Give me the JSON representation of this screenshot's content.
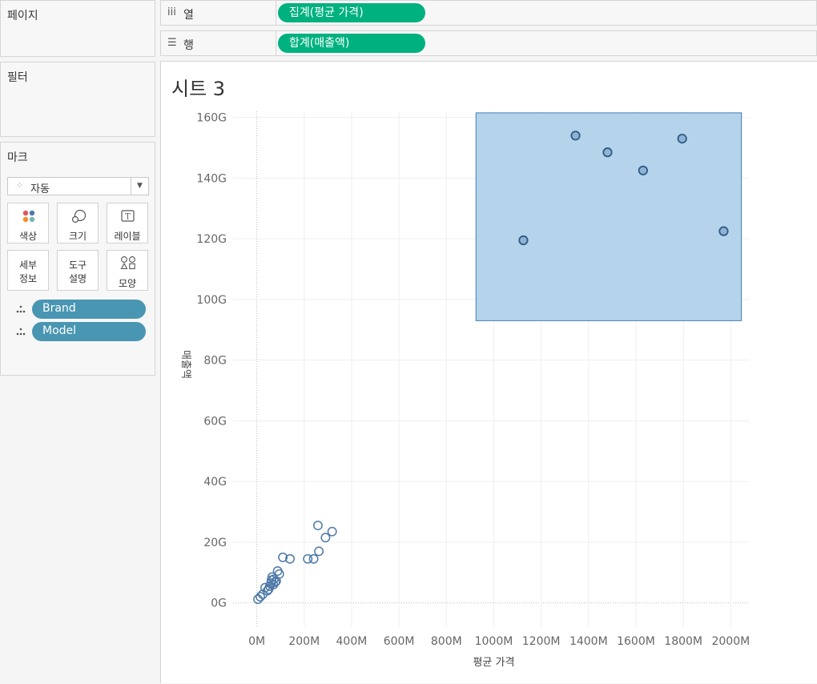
{
  "sidebar": {
    "pages_title": "페이지",
    "filters_title": "필터",
    "marks_title": "마크",
    "mark_type": "자동",
    "mark_buttons": {
      "color": "색상",
      "size": "크기",
      "label": "레이블",
      "detail_line1": "세부",
      "detail_line2": "정보",
      "tooltip_line1": "도구",
      "tooltip_line2": "설명",
      "shape": "모양"
    },
    "detail_fields": [
      "Brand",
      "Model"
    ]
  },
  "shelves": {
    "columns": {
      "icon": "iii",
      "label": "열",
      "pill": "집계(평균 가격)"
    },
    "rows": {
      "icon": "☰",
      "label": "행",
      "pill": "합계(매출액)"
    }
  },
  "sheet": {
    "title": "시트 3"
  },
  "colors": {
    "shelf_pill": "#00b180",
    "field_pill": "#4996b2",
    "mark_stroke": "#4e79a7",
    "selection_fill": "#b5d3ea",
    "selection_border": "#3f7fb5"
  },
  "chart_data": {
    "type": "scatter",
    "xlabel": "평균 가격",
    "ylabel": "매출액",
    "xlim": [
      -100,
      2080
    ],
    "ylim": [
      -8,
      162
    ],
    "x_ticks": [
      0,
      200,
      400,
      600,
      800,
      1000,
      1200,
      1400,
      1600,
      1800,
      2000
    ],
    "x_tick_labels": [
      "0M",
      "200M",
      "400M",
      "600M",
      "800M",
      "1000M",
      "1200M",
      "1400M",
      "1600M",
      "1800M",
      "2000M"
    ],
    "y_ticks": [
      0,
      20,
      40,
      60,
      80,
      100,
      120,
      140,
      160
    ],
    "y_tick_labels": [
      "0G",
      "20G",
      "40G",
      "60G",
      "80G",
      "100G",
      "120G",
      "140G",
      "160G"
    ],
    "selection": {
      "x": [
        925,
        2045
      ],
      "y": [
        93,
        161.5
      ]
    },
    "points": [
      {
        "x": 1125,
        "y": 119.5,
        "selected": true
      },
      {
        "x": 1345,
        "y": 154,
        "selected": true
      },
      {
        "x": 1480,
        "y": 148.5,
        "selected": true
      },
      {
        "x": 1630,
        "y": 142.5,
        "selected": true
      },
      {
        "x": 1795,
        "y": 153,
        "selected": true
      },
      {
        "x": 1970,
        "y": 122.5,
        "selected": true
      },
      {
        "x": 5,
        "y": 1.2
      },
      {
        "x": 15,
        "y": 2
      },
      {
        "x": 25,
        "y": 2.8
      },
      {
        "x": 35,
        "y": 5
      },
      {
        "x": 45,
        "y": 4
      },
      {
        "x": 50,
        "y": 4.5
      },
      {
        "x": 55,
        "y": 5.5
      },
      {
        "x": 60,
        "y": 6.5
      },
      {
        "x": 62,
        "y": 7.5
      },
      {
        "x": 65,
        "y": 8.5
      },
      {
        "x": 70,
        "y": 6
      },
      {
        "x": 72,
        "y": 7.8
      },
      {
        "x": 78,
        "y": 6.8
      },
      {
        "x": 82,
        "y": 7.2
      },
      {
        "x": 88,
        "y": 10.5
      },
      {
        "x": 95,
        "y": 9.5
      },
      {
        "x": 110,
        "y": 15
      },
      {
        "x": 140,
        "y": 14.5
      },
      {
        "x": 215,
        "y": 14.5
      },
      {
        "x": 240,
        "y": 14.5
      },
      {
        "x": 258,
        "y": 25.5
      },
      {
        "x": 262,
        "y": 17
      },
      {
        "x": 290,
        "y": 21.5
      },
      {
        "x": 318,
        "y": 23.5
      }
    ]
  }
}
